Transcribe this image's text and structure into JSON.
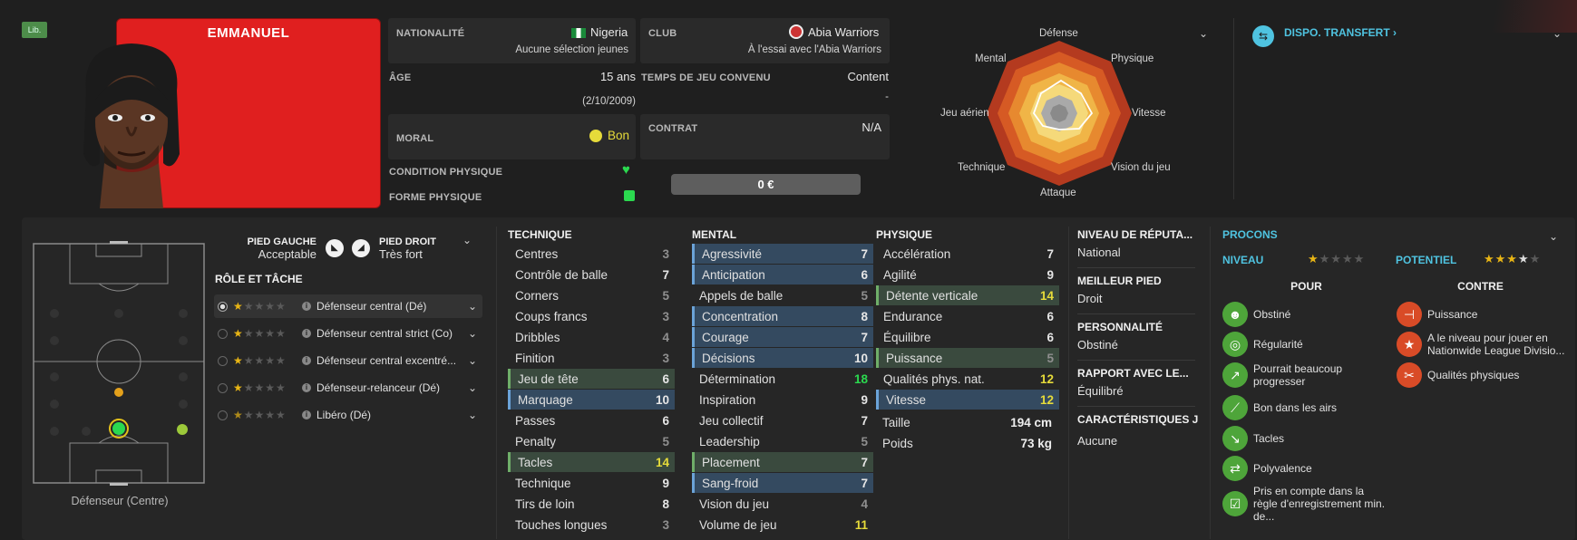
{
  "badge": "Lib.",
  "player": {
    "name": "EMMANUEL"
  },
  "info": {
    "nationality_label": "NATIONALITÉ",
    "nationality": "Nigeria",
    "caps": "Aucune sélection jeunes",
    "club_label": "CLUB",
    "club": "Abia Warriors",
    "club_status": "À l'essai avec l'Abia Warriors",
    "age_label": "ÂGE",
    "age": "15 ans",
    "dob": "(2/10/2009)",
    "playtime_label": "TEMPS DE JEU CONVENU",
    "playtime": "Content",
    "playtime_sub": "-",
    "morale_label": "MORAL",
    "morale": "Bon",
    "contract_label": "CONTRAT",
    "contract": "N/A",
    "condition_label": "CONDITION PHYSIQUE",
    "fitness_label": "FORME PHYSIQUE",
    "value": "0 €"
  },
  "radar": {
    "labels": [
      "Défense",
      "Physique",
      "Vitesse",
      "Vision du jeu",
      "Attaque",
      "Technique",
      "Jeu aérien",
      "Mental"
    ]
  },
  "transfer": {
    "label": "DISPO. TRANSFERT ›"
  },
  "feet": {
    "left_label": "PIED GAUCHE",
    "left": "Acceptable",
    "right_label": "PIED DROIT",
    "right": "Très fort"
  },
  "roles": {
    "title": "RÔLE ET TÂCHE",
    "items": [
      {
        "label": "Défenseur central (Dé)",
        "stars": 1
      },
      {
        "label": "Défenseur central strict (Co)",
        "stars": 1
      },
      {
        "label": "Défenseur central excentré...",
        "stars": 1
      },
      {
        "label": "Défenseur-relanceur (Dé)",
        "stars": 1
      },
      {
        "label": "Libéro (Dé)",
        "stars": 0.5
      }
    ]
  },
  "pitch": {
    "position": "Défenseur (Centre)"
  },
  "technique": {
    "title": "TECHNIQUE",
    "rows": [
      [
        "Centres",
        "3"
      ],
      [
        "Contrôle de balle",
        "7"
      ],
      [
        "Corners",
        "5"
      ],
      [
        "Coups francs",
        "3"
      ],
      [
        "Dribbles",
        "4"
      ],
      [
        "Finition",
        "3"
      ],
      [
        "Jeu de tête",
        "6"
      ],
      [
        "Marquage",
        "10"
      ],
      [
        "Passes",
        "6"
      ],
      [
        "Penalty",
        "5"
      ],
      [
        "Tacles",
        "14"
      ],
      [
        "Technique",
        "9"
      ],
      [
        "Tirs de loin",
        "8"
      ],
      [
        "Touches longues",
        "3"
      ]
    ]
  },
  "mental": {
    "title": "MENTAL",
    "rows": [
      [
        "Agressivité",
        "7"
      ],
      [
        "Anticipation",
        "6"
      ],
      [
        "Appels de balle",
        "5"
      ],
      [
        "Concentration",
        "8"
      ],
      [
        "Courage",
        "7"
      ],
      [
        "Décisions",
        "10"
      ],
      [
        "Détermination",
        "18"
      ],
      [
        "Inspiration",
        "9"
      ],
      [
        "Jeu collectif",
        "7"
      ],
      [
        "Leadership",
        "5"
      ],
      [
        "Placement",
        "7"
      ],
      [
        "Sang-froid",
        "7"
      ],
      [
        "Vision du jeu",
        "4"
      ],
      [
        "Volume de jeu",
        "11"
      ]
    ]
  },
  "physique": {
    "title": "PHYSIQUE",
    "rows": [
      [
        "Accélération",
        "7"
      ],
      [
        "Agilité",
        "9"
      ],
      [
        "Détente verticale",
        "14"
      ],
      [
        "Endurance",
        "6"
      ],
      [
        "Équilibre",
        "6"
      ],
      [
        "Puissance",
        "5"
      ],
      [
        "Qualités phys. nat.",
        "12"
      ],
      [
        "Vitesse",
        "12"
      ]
    ],
    "height_label": "Taille",
    "height": "194 cm",
    "weight_label": "Poids",
    "weight": "73 kg"
  },
  "side": {
    "rep_label": "NIVEAU DE RÉPUTA...",
    "rep": "National",
    "foot_label": "MEILLEUR PIED",
    "foot": "Droit",
    "pers_label": "PERSONNALITÉ",
    "pers": "Obstiné",
    "rel_label": "RAPPORT AVEC LE...",
    "rel": "Équilibré",
    "char_label": "CARACTÉRISTIQUES J",
    "char": "Aucune"
  },
  "procons": {
    "title": "PROCONS",
    "level_label": "NIVEAU",
    "potential_label": "POTENTIEL",
    "level_stars": 1,
    "potential_stars": 3.5,
    "pour_label": "POUR",
    "contre_label": "CONTRE",
    "pour": [
      "Obstiné",
      "Régularité",
      "Pourrait beaucoup progresser",
      "Bon dans les airs",
      "Tacles",
      "Polyvalence",
      "Pris en compte dans la règle d'enregistrement min. de..."
    ],
    "contre": [
      "Puissance",
      "A le niveau pour jouer en Nationwide League Divisio...",
      "Qualités physiques"
    ]
  },
  "colors": {
    "accent": "#4fc3e0",
    "green": "#4ea53a",
    "red": "#d94b27",
    "star": "#e8b515"
  }
}
